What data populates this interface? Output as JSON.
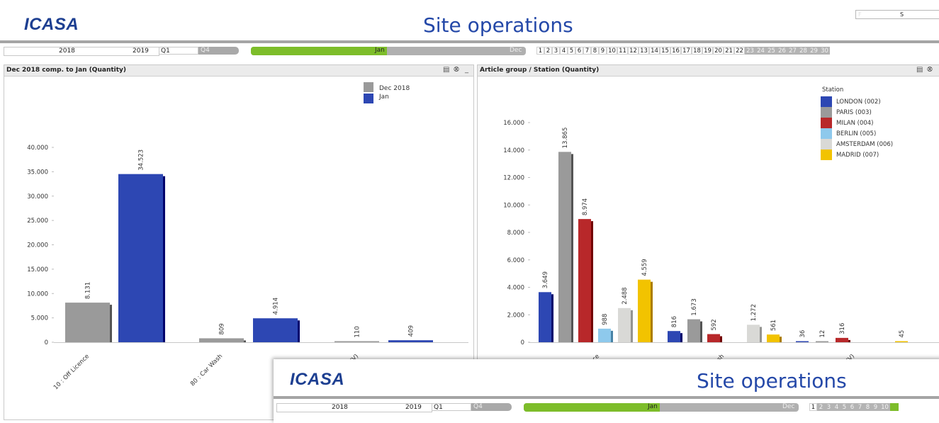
{
  "header": {
    "logo": "ICASA",
    "title": "Site operations",
    "top_right": {
      "left_label": "F",
      "right_label": "S"
    }
  },
  "filters": {
    "year_from": "2018",
    "year_to": "2019",
    "quarter_selected": "Q1",
    "quarter_last": "Q4",
    "month_selected": "Jan",
    "month_last": "Dec",
    "days": [
      "1",
      "2",
      "3",
      "4",
      "5",
      "6",
      "7",
      "8",
      "9",
      "10",
      "11",
      "12",
      "13",
      "14",
      "15",
      "16",
      "17",
      "18",
      "19",
      "20",
      "21",
      "22",
      "23",
      "24",
      "25",
      "26",
      "27",
      "28",
      "29",
      "30"
    ],
    "days_available_upto": 22
  },
  "panel_left": {
    "title": "Dec 2018 comp. to Jan (Quantity)"
  },
  "panel_right": {
    "title": "Article group / Station (Quantity)"
  },
  "overlay": {
    "logo": "ICASA",
    "title": "Site operations",
    "year_from": "2018",
    "year_to": "2019",
    "quarter_selected": "Q1",
    "quarter_last": "Q4",
    "month_selected": "Jan",
    "month_last": "Dec",
    "days": [
      "1",
      "2",
      "3",
      "4",
      "5",
      "6",
      "7",
      "8",
      "9",
      "10"
    ]
  },
  "colors": {
    "dec2018": "#9a9a9a",
    "jan": "#2d47b3",
    "london": "#2d47b3",
    "paris": "#9a9a9a",
    "milan": "#b8282a",
    "berlin": "#8ec9ec",
    "amsterdam": "#d9d9d6",
    "madrid": "#f2c300",
    "green": "#7dbd2a"
  },
  "chart_data": [
    {
      "type": "bar",
      "title": "Dec 2018 comp. to Jan (Quantity)",
      "categories": [
        "10 : Off Licence",
        "80 : Car Wash",
        "(NV)"
      ],
      "series": [
        {
          "name": "Dec 2018",
          "values": [
            8131,
            809,
            110
          ]
        },
        {
          "name": "Jan",
          "values": [
            34523,
            4914,
            409
          ]
        }
      ],
      "value_labels": {
        "Dec 2018": [
          "8.131",
          "809",
          "110"
        ],
        "Jan": [
          "34.523",
          "4.914",
          "409"
        ]
      },
      "yticks": [
        "0",
        "5.000",
        "10.000",
        "15.000",
        "20.000",
        "25.000",
        "30.000",
        "35.000",
        "40.000"
      ],
      "ylim": [
        0,
        40000
      ],
      "legend": "top-right",
      "grid": false
    },
    {
      "type": "bar",
      "title": "Article group / Station (Quantity)",
      "legend_title": "Station",
      "categories": [
        "10 : Off Licence",
        "80 : Car Wash",
        "(NV)"
      ],
      "series": [
        {
          "name": "LONDON (002)",
          "values": [
            3649,
            816,
            36
          ]
        },
        {
          "name": "PARIS (003)",
          "values": [
            13865,
            1673,
            12
          ]
        },
        {
          "name": "MILAN (004)",
          "values": [
            8974,
            592,
            316
          ]
        },
        {
          "name": "BERLIN (005)",
          "values": [
            988,
            null,
            null
          ]
        },
        {
          "name": "AMSTERDAM (006)",
          "values": [
            2488,
            1272,
            null
          ]
        },
        {
          "name": "MADRID (007)",
          "values": [
            4559,
            561,
            45
          ]
        }
      ],
      "value_labels": {
        "LONDON (002)": [
          "3.649",
          "816",
          "36"
        ],
        "PARIS (003)": [
          "13.865",
          "1.673",
          "12"
        ],
        "MILAN (004)": [
          "8.974",
          "592",
          "316"
        ],
        "BERLIN (005)": [
          "988",
          "",
          ""
        ],
        "AMSTERDAM (006)": [
          "2.488",
          "1.272",
          ""
        ],
        "MADRID (007)": [
          "4.559",
          "561",
          "45"
        ]
      },
      "category_labels_visible": [
        "nce",
        "ash",
        "(NV)"
      ],
      "yticks": [
        "0",
        "2.000",
        "4.000",
        "6.000",
        "8.000",
        "10.000",
        "12.000",
        "14.000",
        "16.000"
      ],
      "ylim": [
        0,
        16000
      ],
      "legend": "top-right",
      "grid": false
    }
  ]
}
